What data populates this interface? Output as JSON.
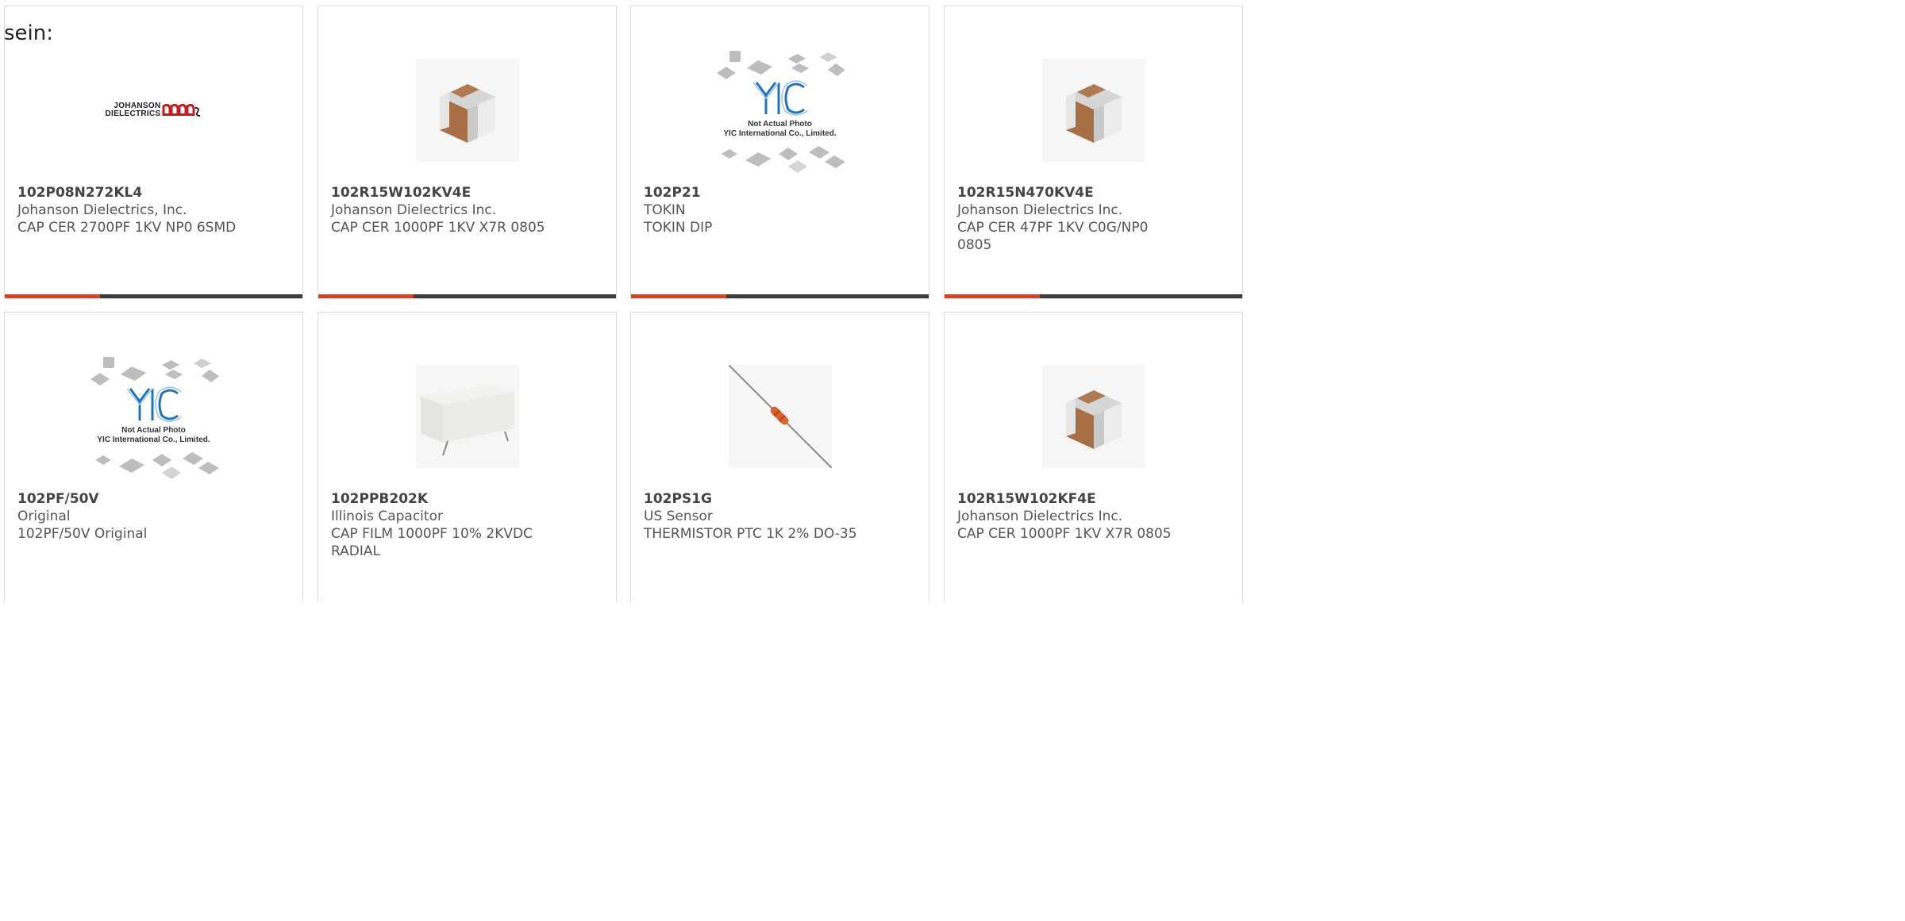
{
  "lead_text": "sein:",
  "products": [
    {
      "part": "102P08N272KL4",
      "manufacturer": "Johanson Dielectrics, Inc.",
      "description": "CAP CER 2700PF 1KV NP0 6SMD",
      "image": "johanson-logo",
      "logo_line1": "JOHANSON",
      "logo_line2": "DIELECTRICS"
    },
    {
      "part": "102R15W102KV4E",
      "manufacturer": "Johanson Dielectrics Inc.",
      "description": "CAP CER 1000PF 1KV X7R 0805",
      "image": "ceramic-chip-capacitor"
    },
    {
      "part": "102P21",
      "manufacturer": "TOKIN",
      "description": "TOKIN DIP",
      "image": "yic-placeholder",
      "placeholder_line1": "Not Actual Photo",
      "placeholder_line2": "YIC International Co., Limited."
    },
    {
      "part": "102R15N470KV4E",
      "manufacturer": "Johanson Dielectrics Inc.",
      "description": "CAP CER 47PF 1KV C0G/NP0 0805",
      "image": "ceramic-chip-capacitor"
    },
    {
      "part": "102PF/50V",
      "manufacturer": "Original",
      "description": "102PF/50V Original",
      "image": "yic-placeholder",
      "placeholder_line1": "Not Actual Photo",
      "placeholder_line2": "YIC International Co., Limited."
    },
    {
      "part": "102PPB202K",
      "manufacturer": "Illinois Capacitor",
      "description": "CAP FILM 1000PF 10% 2KVDC RADIAL",
      "image": "film-capacitor"
    },
    {
      "part": "102PS1G",
      "manufacturer": "US Sensor",
      "description": "THERMISTOR PTC 1K 2% DO-35",
      "image": "thermistor"
    },
    {
      "part": "102R15W102KF4E",
      "manufacturer": "Johanson Dielectrics Inc.",
      "description": "CAP CER 1000PF 1KV X7R 0805",
      "image": "ceramic-chip-capacitor"
    }
  ],
  "colors": {
    "accent": "#e0401b",
    "bar": "#3d3d3d",
    "yic_blue": "#1e73be"
  }
}
